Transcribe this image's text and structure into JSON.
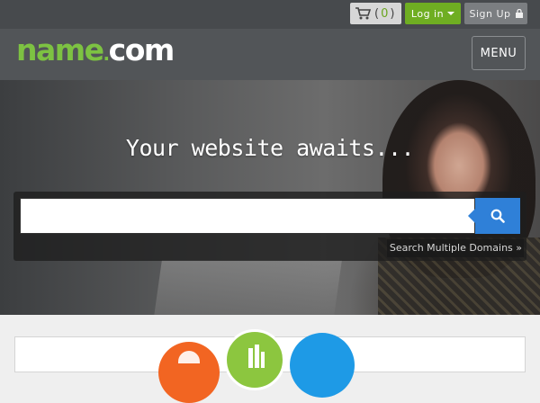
{
  "header": {
    "cart": {
      "count": "0",
      "open_paren": "(",
      "close_paren": ")"
    },
    "login_label": "Log in",
    "signup_label": "Sign Up"
  },
  "nav": {
    "logo_left": "name",
    "logo_dot": ".",
    "logo_right": "com",
    "menu_label": "MENU"
  },
  "hero": {
    "headline": "Your website awaits...",
    "search": {
      "value": "",
      "placeholder": ""
    },
    "multi_link": "Search Multiple Domains »"
  },
  "colors": {
    "brand_green": "#7dc242",
    "login_green": "#6fae22",
    "search_blue": "#2f80d8",
    "topbar": "#474a4d",
    "navbar": "#525558"
  },
  "icons": {
    "cart": "shopping-cart-icon",
    "lock": "lock-icon",
    "search": "search-icon"
  }
}
